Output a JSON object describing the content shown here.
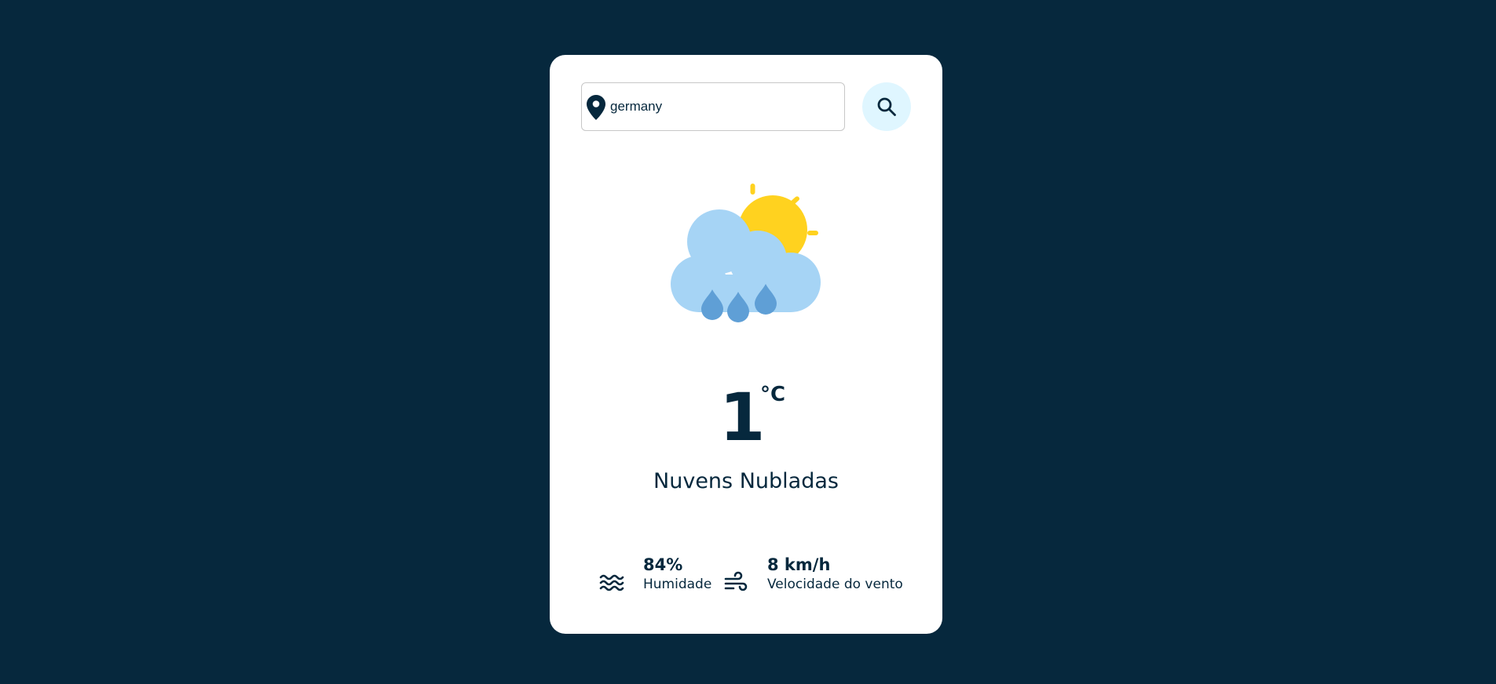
{
  "search": {
    "value": "germany",
    "location_icon": "map-pin-icon",
    "button_icon": "search-icon"
  },
  "weather": {
    "icon": "sun-cloud-rain-icon",
    "temperature": "1",
    "unit": "°C",
    "description": "Nuvens Nubladas"
  },
  "details": {
    "humidity": {
      "icon": "waves-icon",
      "value": "84%",
      "label": "Humidade"
    },
    "wind": {
      "icon": "wind-icon",
      "value": "8 km/h",
      "label": "Velocidade do vento"
    }
  },
  "colors": {
    "background": "#06283d",
    "card": "#ffffff",
    "search_button": "#dff6ff",
    "text": "#06283d",
    "sun": "#ffd21f",
    "cloud": "#a6d4f5",
    "rain": "#5f9fd6"
  }
}
